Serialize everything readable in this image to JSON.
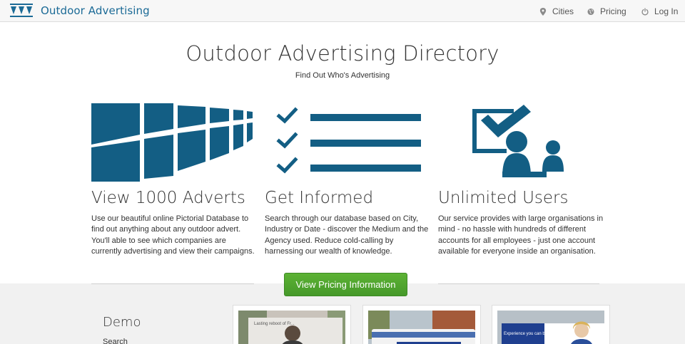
{
  "navbar": {
    "brand": "Outdoor Advertising",
    "items": [
      {
        "label": "Cities",
        "icon": "map-pin-icon"
      },
      {
        "label": "Pricing",
        "icon": "globe-icon"
      },
      {
        "label": "Log In",
        "icon": "power-icon"
      }
    ]
  },
  "hero": {
    "title": "Outdoor Advertising Directory",
    "subtitle": "Find Out Who's Advertising"
  },
  "features": [
    {
      "title": "View 1000 Adverts",
      "text": "Use our beautiful online Pictorial Database to find out anything about any outdoor advert. You'll able to see which companies are currently advertising and view their campaigns.",
      "icon": "billboard-grid-icon"
    },
    {
      "title": "Get Informed",
      "text": "Search through our database based on City, Industry or Date - discover the Medium and the Agency used. Reduce cold-calling by harnessing our wealth of knowledge.",
      "icon": "checklist-icon"
    },
    {
      "title": "Unlimited Users",
      "text": "Our service provides with large organisations in mind - no hassle with hundreds of different accounts for all employees - just one account available for everyone inside an organisation.",
      "icon": "users-check-icon"
    }
  ],
  "cta": {
    "label": "View Pricing Information"
  },
  "demo": {
    "title": "Demo",
    "search_label": "Search",
    "thumbnails": [
      {
        "caption": "Lasting reboot of Fr...",
        "icon": "advert-thumbnail-icon"
      },
      {
        "caption": "",
        "icon": "advert-thumbnail-icon"
      },
      {
        "caption": "Experience you can bank on",
        "icon": "advert-thumbnail-icon"
      }
    ]
  },
  "colors": {
    "brand": "#1b6a96",
    "feature_blue": "#135e84",
    "button_green": "#4ea62e",
    "grey_band": "#f1f1f1"
  }
}
